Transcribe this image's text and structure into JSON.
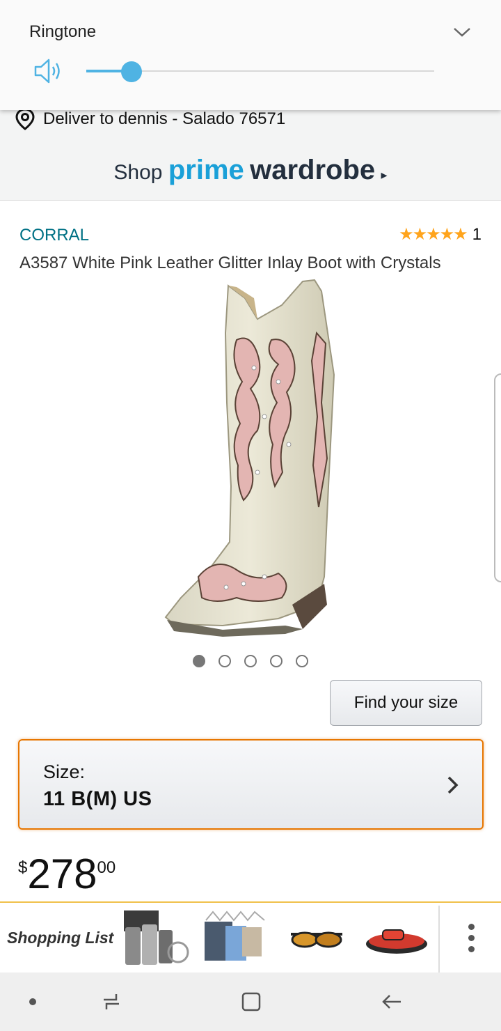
{
  "volume": {
    "title": "Ringtone",
    "level_percent": 13,
    "accent_color": "#4fb3e3",
    "icons": {
      "speaker": "speaker-volume-icon",
      "collapse": "chevron-down-icon"
    }
  },
  "delivery": {
    "text": "Deliver to dennis - Salado 76571",
    "icon": "location-pin-icon"
  },
  "banner": {
    "shop": "Shop",
    "prime": "prime",
    "wardrobe": "wardrobe",
    "caret": "▸",
    "colors": {
      "prime": "#1aa0d8",
      "wardrobe": "#232f3e"
    }
  },
  "product": {
    "brand": "CORRAL",
    "stars": "★★★★★",
    "rating": 5,
    "rating_count": "1",
    "title": "A3587 White Pink Leather Glitter Inlay Boot with Crystals",
    "image": "cowboy-boot-image",
    "image_pager": {
      "count": 5,
      "active_index": 0
    },
    "find_size_label": "Find your size",
    "size_label": "Size:",
    "size_value": "11 B(M) US",
    "price": {
      "symbol": "$",
      "whole": "278",
      "fraction": "00"
    }
  },
  "shopping_list": {
    "label": "Shopping List",
    "items": [
      {
        "name": "tumbler-set-thumbnail"
      },
      {
        "name": "drying-rack-thumbnail"
      },
      {
        "name": "sunglasses-thumbnail"
      },
      {
        "name": "sandals-thumbnail"
      }
    ],
    "more_icon": "more-vertical-icon"
  },
  "nav_bar": {
    "icons": [
      "nav-dot-icon",
      "recent-apps-icon",
      "home-icon",
      "back-icon"
    ]
  }
}
